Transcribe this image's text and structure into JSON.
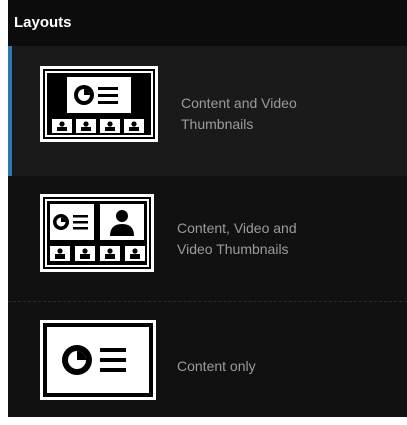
{
  "panel": {
    "title": "Layouts",
    "accent_color": "#2f74b3",
    "background_color": "#111111"
  },
  "layouts": [
    {
      "label": "Content and Video Thumbnails",
      "icon": "content-and-video-thumbnails-icon",
      "selected": true
    },
    {
      "label": "Content, Video and Video Thumbnails",
      "icon": "content-video-and-video-thumbnails-icon",
      "selected": false
    },
    {
      "label": "Content only",
      "icon": "content-only-icon",
      "selected": false
    }
  ]
}
